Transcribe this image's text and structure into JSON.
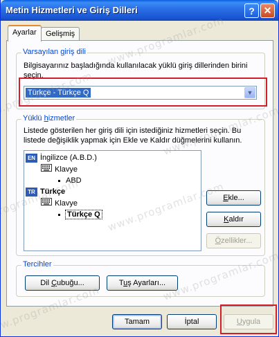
{
  "window": {
    "title": "Metin Hizmetleri ve Giriş Dilleri",
    "help_glyph": "?",
    "close_glyph": "✕"
  },
  "tabs": [
    {
      "label": "Ayarlar",
      "active": true
    },
    {
      "label": "Gelişmiş",
      "active": false
    }
  ],
  "default_language": {
    "group_label_prefix": "Varsayılan ",
    "group_label_underlined": "g",
    "group_label_suffix": "iriş dili",
    "description": "Bilgisayarınız başladığında kullanılacak yüklü giriş dillerinden birini seçin.",
    "selected_value": "Türkçe - Türkçe Q",
    "arrow_glyph": "▼"
  },
  "installed_services": {
    "group_label_prefix": "Yüklü ",
    "group_label_underlined": "h",
    "group_label_suffix": "izmetler",
    "description": "Listede gösterilen her giriş dili için istediğiniz hizmetleri seçin. Bu listede değişiklik yapmak için Ekle ve Kaldır düğmelerini kullanın.",
    "tree": [
      {
        "type": "language",
        "badge": "EN",
        "label": "İngilizce (A.B.D.)"
      },
      {
        "type": "category",
        "label": "Klavye"
      },
      {
        "type": "layout",
        "label": "ABD"
      },
      {
        "type": "language",
        "badge": "TR",
        "label": "Türkçe"
      },
      {
        "type": "category",
        "label": "Klavye"
      },
      {
        "type": "layout",
        "label": "Türkçe Q"
      }
    ],
    "buttons": {
      "add": {
        "u": "E",
        "rest": "kle..."
      },
      "remove": {
        "u": "K",
        "rest": "aldır"
      },
      "properties": {
        "u": "Ö",
        "rest": "zellikler..."
      }
    }
  },
  "preferences": {
    "group_label": "Tercihler",
    "language_bar": {
      "pre": "Dil ",
      "u": "Ç",
      "rest": "ubuğu..."
    },
    "key_settings": {
      "pre": "T",
      "u": "u",
      "rest": "ş Ayarları..."
    }
  },
  "footer": {
    "ok": "Tamam",
    "cancel": "İptal",
    "apply": {
      "u": "U",
      "rest": "ygula"
    }
  },
  "watermark_text": "www.programlar.com",
  "colors": {
    "titlebar": "#2b71e8",
    "selection": "#316ac5",
    "highlight": "#d21e2a",
    "group_label": "#0046d5"
  }
}
